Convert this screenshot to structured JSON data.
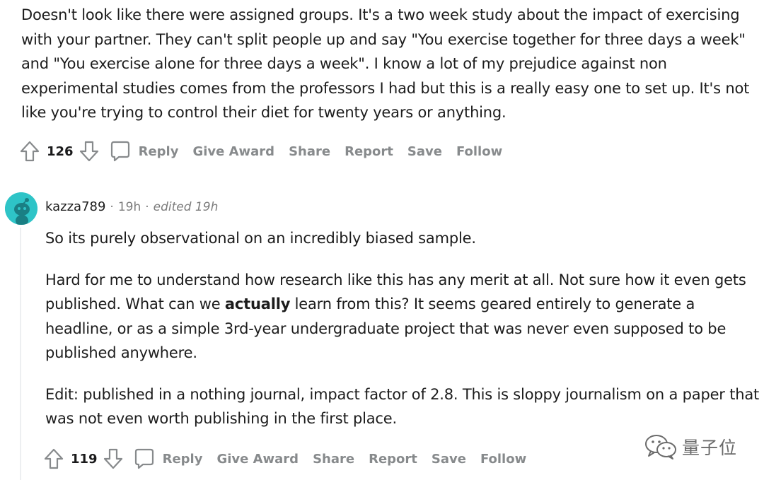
{
  "comment1": {
    "text": "Doesn't look like there were assigned groups. It's a two week study about the impact of exercising with your partner. They can't split people up and say \"You exercise together for three days a week\" and \"You exercise alone for three days a week\". I know a lot of my prejudice against non experimental studies comes from the professors I had but this is a really easy one to set up. It's not like you're trying to control their diet for twenty years or anything.",
    "score": "126"
  },
  "comment2": {
    "username": "kazza789",
    "time": "19h",
    "edited": "edited 19h",
    "p1": "So its purely observational on an incredibly biased sample.",
    "p2_before": "Hard for me to understand how research like this has any merit at all. Not sure how it even gets published. What can we ",
    "p2_bold": "actually",
    "p2_after": " learn from this? It seems geared entirely to generate a headline, or as a simple 3rd-year undergraduate project that was never even supposed to be published anywhere.",
    "p3": "Edit: published in a nothing journal, impact factor of 2.8. This is sloppy journalism on a paper that was not even worth publishing in the first place.",
    "score": "119"
  },
  "actions": {
    "reply": "Reply",
    "give_award": "Give Award",
    "share": "Share",
    "report": "Report",
    "save": "Save",
    "follow": "Follow"
  },
  "meta_separator": "·",
  "watermark": "量子位",
  "icons": [
    "upvote-icon",
    "downvote-icon",
    "comment-bubble-icon",
    "reddit-snoo-avatar",
    "wechat-logo-icon"
  ]
}
